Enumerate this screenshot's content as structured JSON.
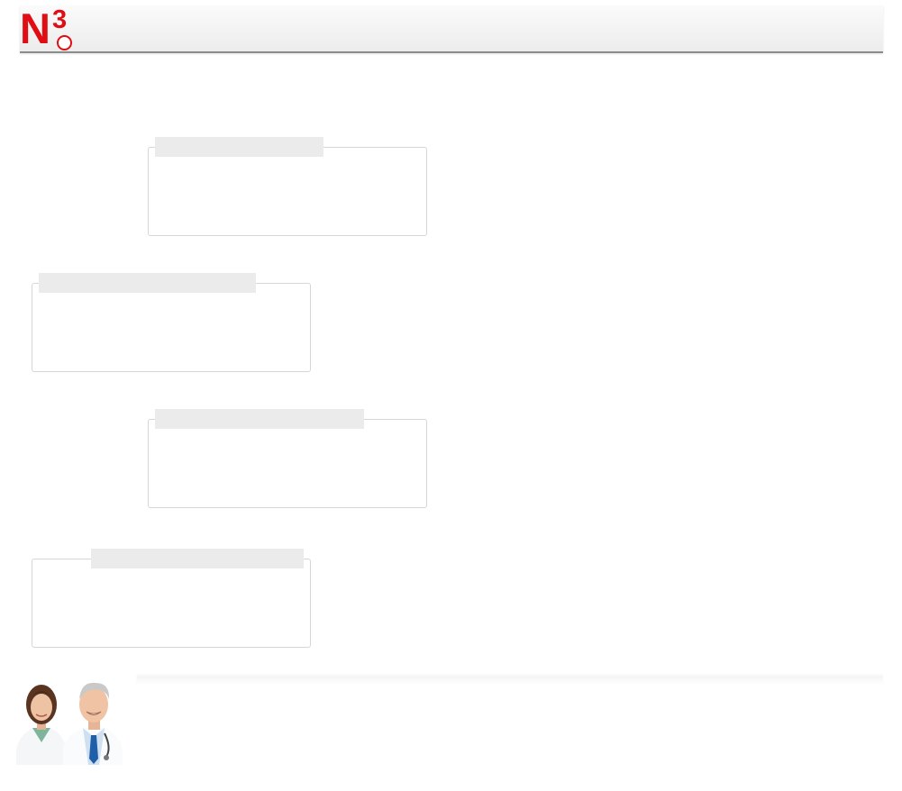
{
  "header": {
    "logo_text": "N3",
    "logo_letter": "N",
    "logo_digit": "3",
    "brand_color": "#e00d14",
    "background": "#f2f2f2"
  },
  "panels": [
    {
      "title": "",
      "body": ""
    },
    {
      "title": "",
      "body": ""
    },
    {
      "title": "",
      "body": ""
    },
    {
      "title": "",
      "body": ""
    }
  ],
  "footer": {
    "image_icon": "doctors-photo"
  }
}
